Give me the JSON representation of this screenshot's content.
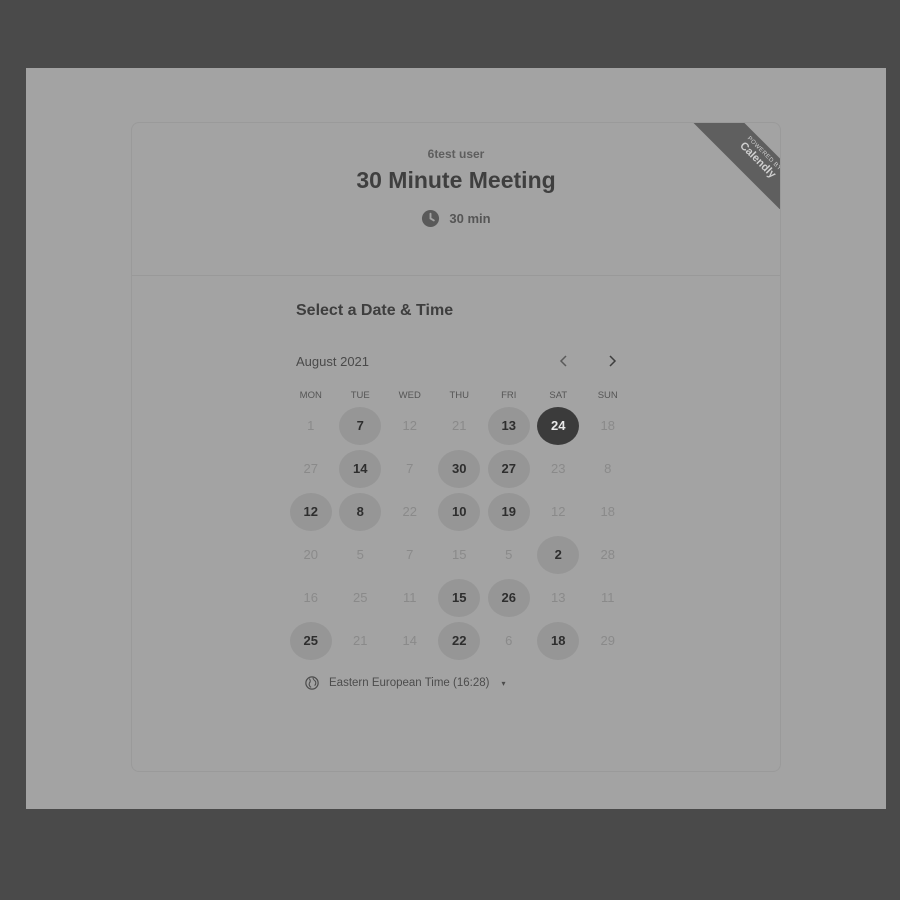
{
  "header": {
    "owner": "6test user",
    "title": "30 Minute Meeting",
    "duration": "30 min",
    "ribbon_top": "POWERED BY",
    "ribbon_brand": "Calendly"
  },
  "scheduler": {
    "heading": "Select a Date & Time",
    "month": "August 2021",
    "prev_icon": "chevron-left-icon",
    "next_icon": "chevron-right-icon",
    "weekdays": [
      "MON",
      "TUE",
      "WED",
      "THU",
      "FRI",
      "SAT",
      "SUN"
    ],
    "days": [
      {
        "label": "1",
        "state": "unavailable"
      },
      {
        "label": "7",
        "state": "available"
      },
      {
        "label": "12",
        "state": "unavailable"
      },
      {
        "label": "21",
        "state": "unavailable"
      },
      {
        "label": "13",
        "state": "available"
      },
      {
        "label": "24",
        "state": "selected"
      },
      {
        "label": "18",
        "state": "unavailable"
      },
      {
        "label": "27",
        "state": "unavailable"
      },
      {
        "label": "14",
        "state": "available"
      },
      {
        "label": "7",
        "state": "unavailable"
      },
      {
        "label": "30",
        "state": "available"
      },
      {
        "label": "27",
        "state": "available"
      },
      {
        "label": "23",
        "state": "unavailable"
      },
      {
        "label": "8",
        "state": "unavailable"
      },
      {
        "label": "12",
        "state": "available"
      },
      {
        "label": "8",
        "state": "available"
      },
      {
        "label": "22",
        "state": "unavailable"
      },
      {
        "label": "10",
        "state": "available"
      },
      {
        "label": "19",
        "state": "available"
      },
      {
        "label": "12",
        "state": "unavailable"
      },
      {
        "label": "18",
        "state": "unavailable"
      },
      {
        "label": "20",
        "state": "unavailable"
      },
      {
        "label": "5",
        "state": "unavailable"
      },
      {
        "label": "7",
        "state": "unavailable"
      },
      {
        "label": "15",
        "state": "unavailable"
      },
      {
        "label": "5",
        "state": "unavailable"
      },
      {
        "label": "2",
        "state": "available"
      },
      {
        "label": "28",
        "state": "unavailable"
      },
      {
        "label": "16",
        "state": "unavailable"
      },
      {
        "label": "25",
        "state": "unavailable"
      },
      {
        "label": "11",
        "state": "unavailable"
      },
      {
        "label": "15",
        "state": "available"
      },
      {
        "label": "26",
        "state": "available"
      },
      {
        "label": "13",
        "state": "unavailable"
      },
      {
        "label": "11",
        "state": "unavailable"
      },
      {
        "label": "25",
        "state": "available"
      },
      {
        "label": "21",
        "state": "unavailable"
      },
      {
        "label": "14",
        "state": "unavailable"
      },
      {
        "label": "22",
        "state": "available"
      },
      {
        "label": "6",
        "state": "unavailable"
      },
      {
        "label": "18",
        "state": "available"
      },
      {
        "label": "29",
        "state": "unavailable"
      }
    ],
    "timezone": "Eastern European Time (16:28)",
    "timezone_icon": "globe-icon",
    "timezone_caret": "▾"
  },
  "colors": {
    "page_bg": "#4a4a4a",
    "card_bg": "#a3a3a3",
    "selected": "#3b3b3b",
    "available": "#969696"
  }
}
